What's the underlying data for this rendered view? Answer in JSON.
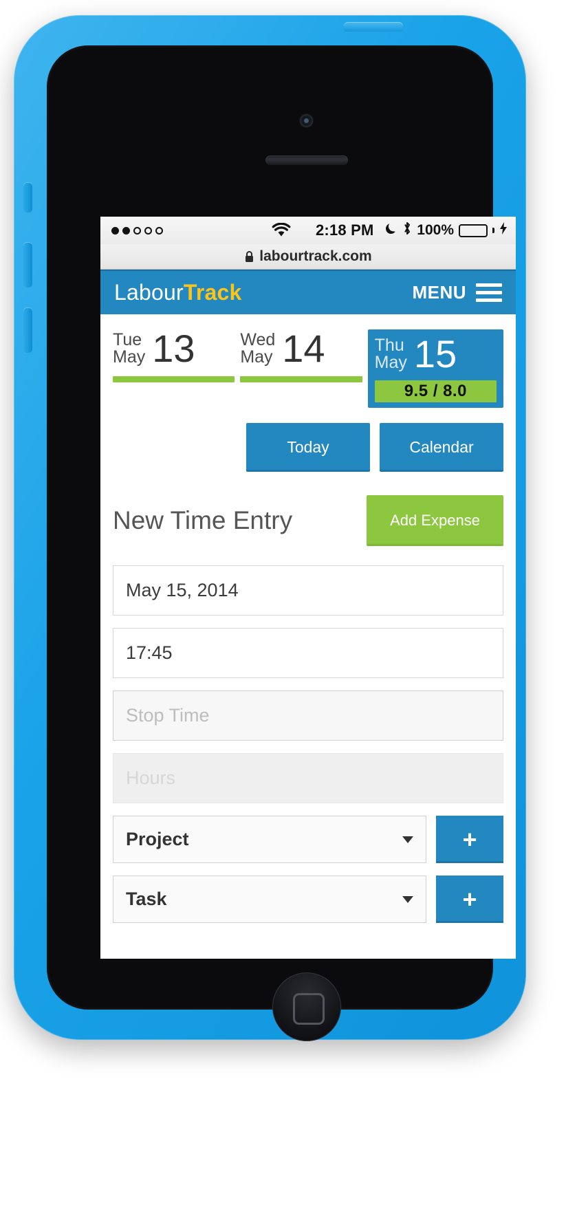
{
  "status_bar": {
    "signal_dots_filled": 2,
    "signal_dots_total": 5,
    "wifi_icon": "wifi-icon",
    "time": "2:18 PM",
    "moon_icon": "moon-icon",
    "bluetooth_icon": "bluetooth-icon",
    "battery_percent": "100%",
    "battery_level": 100,
    "charging_icon": "lightning-bolt-icon"
  },
  "browser": {
    "lock_icon": "lock-icon",
    "url": "labourtrack.com"
  },
  "app_header": {
    "brand_part1": "Labour",
    "brand_part2": "Track",
    "menu_label": "MENU",
    "menu_icon": "hamburger-icon"
  },
  "dates": [
    {
      "weekday": "Tue",
      "month": "May",
      "day": "13",
      "active": false,
      "hours": ""
    },
    {
      "weekday": "Wed",
      "month": "May",
      "day": "14",
      "active": false,
      "hours": ""
    },
    {
      "weekday": "Thu",
      "month": "May",
      "day": "15",
      "active": true,
      "hours": "9.5 / 8.0"
    }
  ],
  "nav_buttons": {
    "today": "Today",
    "calendar": "Calendar"
  },
  "section": {
    "title": "New Time Entry",
    "add_expense": "Add Expense"
  },
  "form": {
    "date_value": "May 15, 2014",
    "start_time_value": "17:45",
    "stop_time_placeholder": "Stop Time",
    "hours_placeholder": "Hours",
    "project_label": "Project",
    "task_label": "Task",
    "add_project_label": "+",
    "add_task_label": "+"
  },
  "colors": {
    "brand_blue": "#2387c0",
    "brand_yellow": "#fcc419",
    "accent_green": "#8dc63f",
    "phone_blue": "#1aa3e8"
  }
}
